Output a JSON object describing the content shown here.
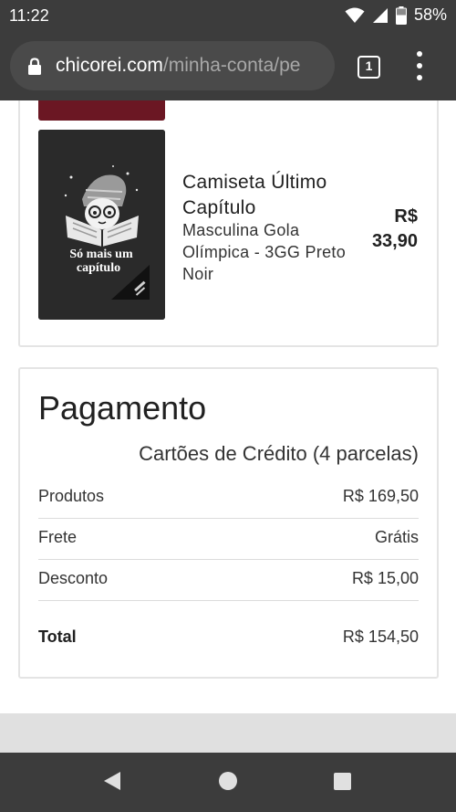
{
  "status_bar": {
    "time": "11:22",
    "battery": "58%"
  },
  "browser": {
    "url_domain": "chicorei.com",
    "url_path": "/minha-conta/pe",
    "tab_count": "1"
  },
  "order": {
    "product": {
      "name": "Camiseta Último Capítulo",
      "variant": "Masculina Gola Olímpica - 3GG Preto Noir",
      "price": "R$ 33,90",
      "print_text_line1": "Só mais um",
      "print_text_line2": "capítulo"
    }
  },
  "payment": {
    "title": "Pagamento",
    "method": "Cartões de Crédito (4 parcelas)",
    "rows": [
      {
        "label": "Produtos",
        "value": "R$ 169,50"
      },
      {
        "label": "Frete",
        "value": "Grátis"
      },
      {
        "label": "Desconto",
        "value": "R$ 15,00"
      }
    ],
    "total": {
      "label": "Total",
      "value": "R$ 154,50"
    }
  },
  "colors": {
    "browser_chrome": "#3c3c3c",
    "previous_item_thumb": "#6b1723",
    "product_thumb": "#2a2a2a"
  }
}
